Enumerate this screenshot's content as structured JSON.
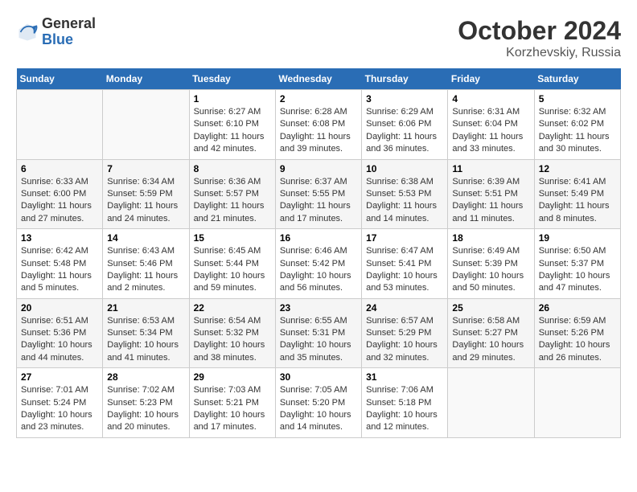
{
  "header": {
    "logo_general": "General",
    "logo_blue": "Blue",
    "month_title": "October 2024",
    "location": "Korzhevskiy, Russia"
  },
  "weekdays": [
    "Sunday",
    "Monday",
    "Tuesday",
    "Wednesday",
    "Thursday",
    "Friday",
    "Saturday"
  ],
  "weeks": [
    [
      {
        "day": "",
        "info": ""
      },
      {
        "day": "",
        "info": ""
      },
      {
        "day": "1",
        "info": "Sunrise: 6:27 AM\nSunset: 6:10 PM\nDaylight: 11 hours and 42 minutes."
      },
      {
        "day": "2",
        "info": "Sunrise: 6:28 AM\nSunset: 6:08 PM\nDaylight: 11 hours and 39 minutes."
      },
      {
        "day": "3",
        "info": "Sunrise: 6:29 AM\nSunset: 6:06 PM\nDaylight: 11 hours and 36 minutes."
      },
      {
        "day": "4",
        "info": "Sunrise: 6:31 AM\nSunset: 6:04 PM\nDaylight: 11 hours and 33 minutes."
      },
      {
        "day": "5",
        "info": "Sunrise: 6:32 AM\nSunset: 6:02 PM\nDaylight: 11 hours and 30 minutes."
      }
    ],
    [
      {
        "day": "6",
        "info": "Sunrise: 6:33 AM\nSunset: 6:00 PM\nDaylight: 11 hours and 27 minutes."
      },
      {
        "day": "7",
        "info": "Sunrise: 6:34 AM\nSunset: 5:59 PM\nDaylight: 11 hours and 24 minutes."
      },
      {
        "day": "8",
        "info": "Sunrise: 6:36 AM\nSunset: 5:57 PM\nDaylight: 11 hours and 21 minutes."
      },
      {
        "day": "9",
        "info": "Sunrise: 6:37 AM\nSunset: 5:55 PM\nDaylight: 11 hours and 17 minutes."
      },
      {
        "day": "10",
        "info": "Sunrise: 6:38 AM\nSunset: 5:53 PM\nDaylight: 11 hours and 14 minutes."
      },
      {
        "day": "11",
        "info": "Sunrise: 6:39 AM\nSunset: 5:51 PM\nDaylight: 11 hours and 11 minutes."
      },
      {
        "day": "12",
        "info": "Sunrise: 6:41 AM\nSunset: 5:49 PM\nDaylight: 11 hours and 8 minutes."
      }
    ],
    [
      {
        "day": "13",
        "info": "Sunrise: 6:42 AM\nSunset: 5:48 PM\nDaylight: 11 hours and 5 minutes."
      },
      {
        "day": "14",
        "info": "Sunrise: 6:43 AM\nSunset: 5:46 PM\nDaylight: 11 hours and 2 minutes."
      },
      {
        "day": "15",
        "info": "Sunrise: 6:45 AM\nSunset: 5:44 PM\nDaylight: 10 hours and 59 minutes."
      },
      {
        "day": "16",
        "info": "Sunrise: 6:46 AM\nSunset: 5:42 PM\nDaylight: 10 hours and 56 minutes."
      },
      {
        "day": "17",
        "info": "Sunrise: 6:47 AM\nSunset: 5:41 PM\nDaylight: 10 hours and 53 minutes."
      },
      {
        "day": "18",
        "info": "Sunrise: 6:49 AM\nSunset: 5:39 PM\nDaylight: 10 hours and 50 minutes."
      },
      {
        "day": "19",
        "info": "Sunrise: 6:50 AM\nSunset: 5:37 PM\nDaylight: 10 hours and 47 minutes."
      }
    ],
    [
      {
        "day": "20",
        "info": "Sunrise: 6:51 AM\nSunset: 5:36 PM\nDaylight: 10 hours and 44 minutes."
      },
      {
        "day": "21",
        "info": "Sunrise: 6:53 AM\nSunset: 5:34 PM\nDaylight: 10 hours and 41 minutes."
      },
      {
        "day": "22",
        "info": "Sunrise: 6:54 AM\nSunset: 5:32 PM\nDaylight: 10 hours and 38 minutes."
      },
      {
        "day": "23",
        "info": "Sunrise: 6:55 AM\nSunset: 5:31 PM\nDaylight: 10 hours and 35 minutes."
      },
      {
        "day": "24",
        "info": "Sunrise: 6:57 AM\nSunset: 5:29 PM\nDaylight: 10 hours and 32 minutes."
      },
      {
        "day": "25",
        "info": "Sunrise: 6:58 AM\nSunset: 5:27 PM\nDaylight: 10 hours and 29 minutes."
      },
      {
        "day": "26",
        "info": "Sunrise: 6:59 AM\nSunset: 5:26 PM\nDaylight: 10 hours and 26 minutes."
      }
    ],
    [
      {
        "day": "27",
        "info": "Sunrise: 7:01 AM\nSunset: 5:24 PM\nDaylight: 10 hours and 23 minutes."
      },
      {
        "day": "28",
        "info": "Sunrise: 7:02 AM\nSunset: 5:23 PM\nDaylight: 10 hours and 20 minutes."
      },
      {
        "day": "29",
        "info": "Sunrise: 7:03 AM\nSunset: 5:21 PM\nDaylight: 10 hours and 17 minutes."
      },
      {
        "day": "30",
        "info": "Sunrise: 7:05 AM\nSunset: 5:20 PM\nDaylight: 10 hours and 14 minutes."
      },
      {
        "day": "31",
        "info": "Sunrise: 7:06 AM\nSunset: 5:18 PM\nDaylight: 10 hours and 12 minutes."
      },
      {
        "day": "",
        "info": ""
      },
      {
        "day": "",
        "info": ""
      }
    ]
  ]
}
